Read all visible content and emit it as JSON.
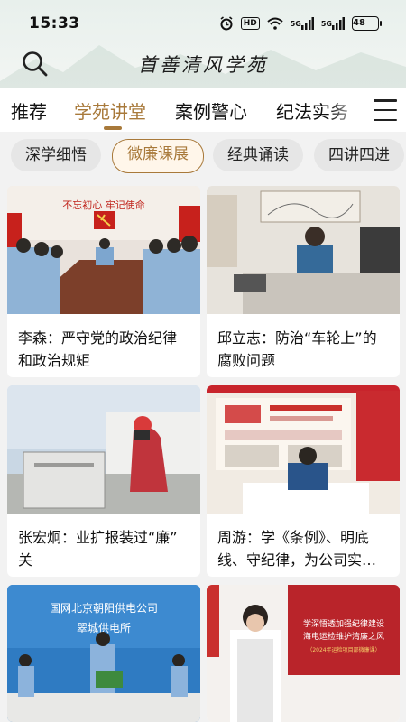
{
  "status_bar": {
    "time": "15:33",
    "icons": [
      "alarm-icon",
      "hd-icon",
      "wifi-icon",
      "signal-5g-icon",
      "signal-5g-icon",
      "battery-icon"
    ],
    "hd_label": "HD",
    "sig1_label": "5G",
    "sig2_label": "5G",
    "battery": "48"
  },
  "header": {
    "brand_title": "首善清风学苑",
    "search_icon": "search-icon"
  },
  "tabs": {
    "items": [
      "推荐",
      "学苑讲堂",
      "案例警心",
      "纪法实务"
    ],
    "active_index": 1,
    "menu_icon": "menu-icon",
    "accent_color": "#a8793a"
  },
  "chips": {
    "items": [
      "深学细悟",
      "微廉课展",
      "经典诵读",
      "四讲四进"
    ],
    "active_index": 1
  },
  "cards": [
    {
      "title": "李森：严守党的政治纪律和政治规矩",
      "title_lines": [
        "李森：严守党的政治纪律",
        "和政治规矩"
      ],
      "wall_text": "不忘初心  牢记使命"
    },
    {
      "title": "邱立志：防治“车轮上”的腐败问题",
      "title_lines": [
        "邱立志：防治“车轮上”的",
        "腐败问题"
      ]
    },
    {
      "title": "张宏炯：业扩报装过“廉”关",
      "title_lines": [
        "张宏炯：业扩报装过“廉”",
        "关"
      ]
    },
    {
      "title": "周游：学《条例》、明底线、守纪律，为公司实…",
      "title_lines": [
        "周游：学《条例》、明底",
        "线、守纪律，为公司实…"
      ]
    },
    {
      "title": "",
      "banner_text": "国网北京朝阳供电公司",
      "banner_text2": "翠城供电所"
    },
    {
      "title": "",
      "banner_text": "学深悟透加强纪律建设",
      "banner_text2": "海电运检维护清廉之风",
      "banner_text3": "（2024年运检项目部微廉课）"
    }
  ]
}
